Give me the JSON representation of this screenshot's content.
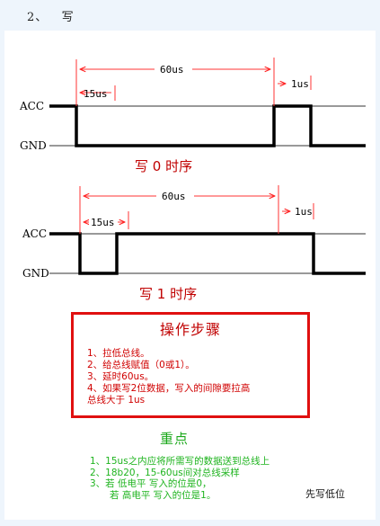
{
  "header": {
    "title": "2、   写"
  },
  "diagram0": {
    "acc": "ACC",
    "gnd": "GND",
    "t_total": "60us",
    "t_low": "15us",
    "t_gap": "1us",
    "caption": "写 0 时序"
  },
  "diagram1": {
    "acc": "ACC",
    "gnd": "GND",
    "t_total": "60us",
    "t_low": "15us",
    "t_gap": "1us",
    "caption": "写 1 时序"
  },
  "steps": {
    "heading": "操作步骤",
    "items": [
      "1、拉低总线。",
      "2、给总线赋值（0或1）。",
      "3、延时60us。",
      "4、如果写2位数据，写入的间隙要拉高",
      "总线大于  1us"
    ]
  },
  "key": {
    "heading": "重点",
    "items": [
      "1、15us之内应将所需写的数据送到总线上",
      "2、18b20，15-60us间对总线采样",
      "3、若 低电平  写入的位是0，",
      "若 高电平  写入的位是1。"
    ]
  },
  "note": "先写低位",
  "colors": {
    "steps_border": "#e01010",
    "steps_text": "#d00000",
    "key_text": "#1fb41f",
    "caption": "#c00000"
  }
}
